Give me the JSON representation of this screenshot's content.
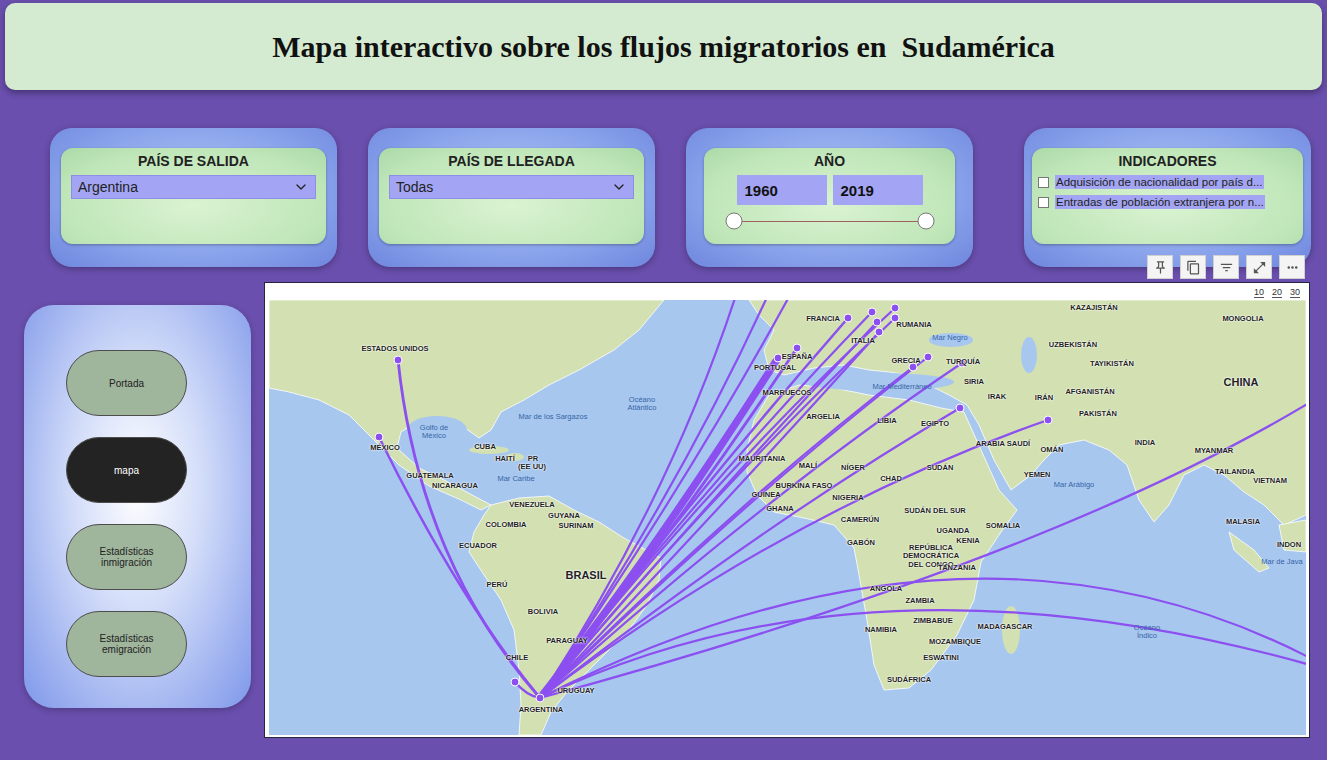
{
  "title": "Mapa interactivo sobre los flujos migratorios en  Sudamérica",
  "filters": {
    "departure": {
      "label": "PAÍS DE SALIDA",
      "value": "Argentina"
    },
    "arrival": {
      "label": "PAÍS DE LLEGADA",
      "value": "Todas"
    },
    "year": {
      "label": "AÑO",
      "from": "1960",
      "to": "2019",
      "start_level": 0,
      "end_level": 1
    },
    "indicators": {
      "label": "INDICADORES",
      "options": [
        {
          "label": "Adquisición de nacionalidad por país d...",
          "checked": false
        },
        {
          "label": "Entradas de población extranjera por n...",
          "checked": false
        }
      ]
    }
  },
  "nav": {
    "items": [
      {
        "label": "Portada",
        "selected": false
      },
      {
        "label": "mapa",
        "selected": true
      },
      {
        "label": "Estadísticas inmigración",
        "selected": false
      },
      {
        "label": "Estadísticas emigración",
        "selected": false
      }
    ]
  },
  "map": {
    "scale": [
      "10",
      "20",
      "30"
    ],
    "labels": [
      {
        "text": "ESTADOS UNIDOS",
        "kind": "country"
      },
      {
        "text": "MÉXICO",
        "kind": "country"
      },
      {
        "text": "GUATEMALA",
        "kind": "country"
      },
      {
        "text": "NICARAGUA",
        "kind": "country"
      },
      {
        "text": "CUBA",
        "kind": "country"
      },
      {
        "text": "HAITÍ",
        "kind": "country"
      },
      {
        "text": "PR",
        "kind": "country"
      },
      {
        "text": "(EE UU)",
        "kind": "country"
      },
      {
        "text": "VENEZUELA",
        "kind": "country"
      },
      {
        "text": "COLOMBIA",
        "kind": "country"
      },
      {
        "text": "GUYANA",
        "kind": "country"
      },
      {
        "text": "SURINAM",
        "kind": "country"
      },
      {
        "text": "ECUADOR",
        "kind": "country"
      },
      {
        "text": "PERÚ",
        "kind": "country"
      },
      {
        "text": "BRASIL",
        "kind": "major"
      },
      {
        "text": "BOLIVIA",
        "kind": "country"
      },
      {
        "text": "PARAGUAY",
        "kind": "country"
      },
      {
        "text": "CHILE",
        "kind": "country"
      },
      {
        "text": "URUGUAY",
        "kind": "country"
      },
      {
        "text": "ARGENTINA",
        "kind": "country"
      },
      {
        "text": "FRANCIA",
        "kind": "country"
      },
      {
        "text": "ESPAÑA",
        "kind": "country"
      },
      {
        "text": "PORTUGAL",
        "kind": "country"
      },
      {
        "text": "ITALIA",
        "kind": "country"
      },
      {
        "text": "RUMANIA",
        "kind": "country"
      },
      {
        "text": "GRECIA",
        "kind": "country"
      },
      {
        "text": "TURQUÍA",
        "kind": "country"
      },
      {
        "text": "MARRUECOS",
        "kind": "country"
      },
      {
        "text": "ARGELIA",
        "kind": "country"
      },
      {
        "text": "LIBIA",
        "kind": "country"
      },
      {
        "text": "EGIPTO",
        "kind": "country"
      },
      {
        "text": "SIRIA",
        "kind": "country"
      },
      {
        "text": "IRAK",
        "kind": "country"
      },
      {
        "text": "IRÁN",
        "kind": "country"
      },
      {
        "text": "ARABIA SAUDÍ",
        "kind": "country"
      },
      {
        "text": "OMÁN",
        "kind": "country"
      },
      {
        "text": "YEMEN",
        "kind": "country"
      },
      {
        "text": "KAZAJISTÁN",
        "kind": "country"
      },
      {
        "text": "MONGOLIA",
        "kind": "country"
      },
      {
        "text": "UZBEKISTÁN",
        "kind": "country"
      },
      {
        "text": "TAYIKISTÁN",
        "kind": "country"
      },
      {
        "text": "AFGANISTÁN",
        "kind": "country"
      },
      {
        "text": "PAKISTÁN",
        "kind": "country"
      },
      {
        "text": "CHINA",
        "kind": "major"
      },
      {
        "text": "INDIA",
        "kind": "country"
      },
      {
        "text": "MYANMAR",
        "kind": "country"
      },
      {
        "text": "TAILANDIA",
        "kind": "country"
      },
      {
        "text": "VIETNAM",
        "kind": "country"
      },
      {
        "text": "MALASIA",
        "kind": "country"
      },
      {
        "text": "INDON",
        "kind": "country"
      },
      {
        "text": "MAURITANIA",
        "kind": "country"
      },
      {
        "text": "MALÍ",
        "kind": "country"
      },
      {
        "text": "NÍGER",
        "kind": "country"
      },
      {
        "text": "CHAD",
        "kind": "country"
      },
      {
        "text": "SUDÁN",
        "kind": "country"
      },
      {
        "text": "BURKINA FASO",
        "kind": "country"
      },
      {
        "text": "GUINEA",
        "kind": "country"
      },
      {
        "text": "GHANA",
        "kind": "country"
      },
      {
        "text": "NIGERIA",
        "kind": "country"
      },
      {
        "text": "CAMERÚN",
        "kind": "country"
      },
      {
        "text": "SUDÁN DEL SUR",
        "kind": "country"
      },
      {
        "text": "GABÓN",
        "kind": "country"
      },
      {
        "text": "REPÚBLICA DEMOCRÁTICA DEL CONGO",
        "kind": "country"
      },
      {
        "text": "UGANDA",
        "kind": "country"
      },
      {
        "text": "KENIA",
        "kind": "country"
      },
      {
        "text": "SOMALIA",
        "kind": "country"
      },
      {
        "text": "TANZANIA",
        "kind": "country"
      },
      {
        "text": "ANGOLA",
        "kind": "country"
      },
      {
        "text": "ZAMBIA",
        "kind": "country"
      },
      {
        "text": "ZIMBABUE",
        "kind": "country"
      },
      {
        "text": "NAMIBIA",
        "kind": "country"
      },
      {
        "text": "MOZAMBIQUE",
        "kind": "country"
      },
      {
        "text": "MADAGASCAR",
        "kind": "country"
      },
      {
        "text": "ESWATINI",
        "kind": "country"
      },
      {
        "text": "SUDÁFRICA",
        "kind": "country"
      },
      {
        "text": "Océano Atlántico",
        "kind": "water"
      },
      {
        "text": "Mar de los Sargazos",
        "kind": "water"
      },
      {
        "text": "Golfo de México",
        "kind": "water"
      },
      {
        "text": "Mar Caribe",
        "kind": "water"
      },
      {
        "text": "Mar Mediterráneo",
        "kind": "water"
      },
      {
        "text": "Mar Negro",
        "kind": "water"
      },
      {
        "text": "Mar Arábigo",
        "kind": "water"
      },
      {
        "text": "Mar de Java",
        "kind": "water"
      },
      {
        "text": "Océano Índico",
        "kind": "water"
      }
    ],
    "flows": [
      {
        "level": 0.25
      },
      {
        "level": 0.2
      },
      {
        "level": 0.2
      },
      {
        "level": 1
      },
      {
        "level": 0.25
      },
      {
        "level": 0.2
      },
      {
        "level": 0.15
      },
      {
        "level": 0.15
      },
      {
        "level": 0.15
      },
      {
        "level": 0.15
      },
      {
        "level": 0.15
      },
      {
        "level": 0.15
      },
      {
        "level": 0.15
      },
      {
        "level": 0.15
      },
      {
        "level": 0.15
      },
      {
        "level": 0.15
      },
      {
        "level": 0.15
      },
      {
        "level": 0.15
      },
      {
        "level": 0.15
      },
      {
        "level": 0.15
      },
      {
        "level": 0.15
      },
      {
        "level": 0.15
      }
    ]
  }
}
